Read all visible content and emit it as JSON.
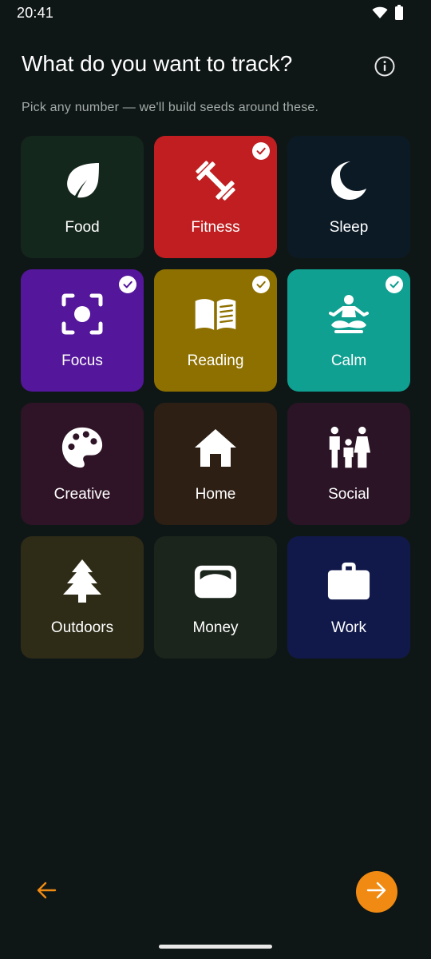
{
  "status_bar": {
    "time": "20:41",
    "icons": [
      "wifi-icon",
      "battery-icon"
    ]
  },
  "header": {
    "title": "What do you want to track?",
    "subtitle": "Pick any number — we'll build seeds around these.",
    "info_icon": "info-icon"
  },
  "categories": [
    {
      "label": "Food",
      "icon": "leaf-icon",
      "color": "#14271c",
      "selected": false
    },
    {
      "label": "Fitness",
      "icon": "dumbbell-icon",
      "color": "#c01e20",
      "selected": true
    },
    {
      "label": "Sleep",
      "icon": "moon-icon",
      "color": "#0c1a26",
      "selected": false
    },
    {
      "label": "Focus",
      "icon": "focus-icon",
      "color": "#54169a",
      "selected": true
    },
    {
      "label": "Reading",
      "icon": "book-icon",
      "color": "#8e7000",
      "selected": true
    },
    {
      "label": "Calm",
      "icon": "meditation-icon",
      "color": "#0fa091",
      "selected": true
    },
    {
      "label": "Creative",
      "icon": "palette-icon",
      "color": "#2e1426",
      "selected": false
    },
    {
      "label": "Home",
      "icon": "home-icon",
      "color": "#2e1f15",
      "selected": false
    },
    {
      "label": "Social",
      "icon": "family-icon",
      "color": "#2a1426",
      "selected": false
    },
    {
      "label": "Outdoors",
      "icon": "tree-icon",
      "color": "#2e2c17",
      "selected": false
    },
    {
      "label": "Money",
      "icon": "wallet-icon",
      "color": "#1b251c",
      "selected": false
    },
    {
      "label": "Work",
      "icon": "briefcase-icon",
      "color": "#11194a",
      "selected": false
    }
  ],
  "footer": {
    "back_icon": "arrow-left-icon",
    "next_icon": "arrow-right-icon",
    "accent": "#f08a12"
  }
}
